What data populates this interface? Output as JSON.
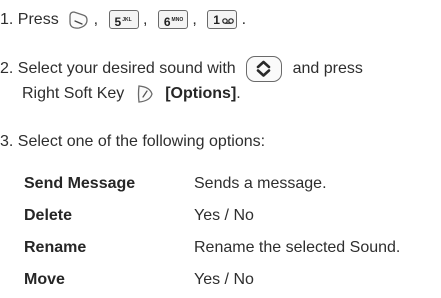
{
  "steps": {
    "step1": {
      "prefix": "1. Press",
      "sep": ",",
      "end": ".",
      "keys": [
        {
          "icon": "end-key-icon"
        },
        {
          "digit": "5",
          "letters": "JKL"
        },
        {
          "digit": "6",
          "letters": "MNO"
        },
        {
          "digit": "1",
          "letters": "voicemail"
        }
      ]
    },
    "step2": {
      "line1": "2. Select your desired sound with",
      "line1_tail": "and press",
      "line2": "Right Soft Key",
      "line2_bold": "[Options]",
      "line2_end": "."
    },
    "step3": {
      "line": "3. Select one of the following options:"
    }
  },
  "options": [
    {
      "name": "Send Message",
      "desc": "Sends a message."
    },
    {
      "name": "Delete",
      "desc": "Yes / No"
    },
    {
      "name": "Rename",
      "desc": "Rename the selected Sound."
    },
    {
      "name": "Move",
      "desc": "Yes / No"
    }
  ],
  "icons": {
    "end_key": "end-key-icon",
    "nav_key": "navigation-key-icon",
    "soft_key": "right-soft-key-icon",
    "voicemail": "voicemail-icon"
  }
}
